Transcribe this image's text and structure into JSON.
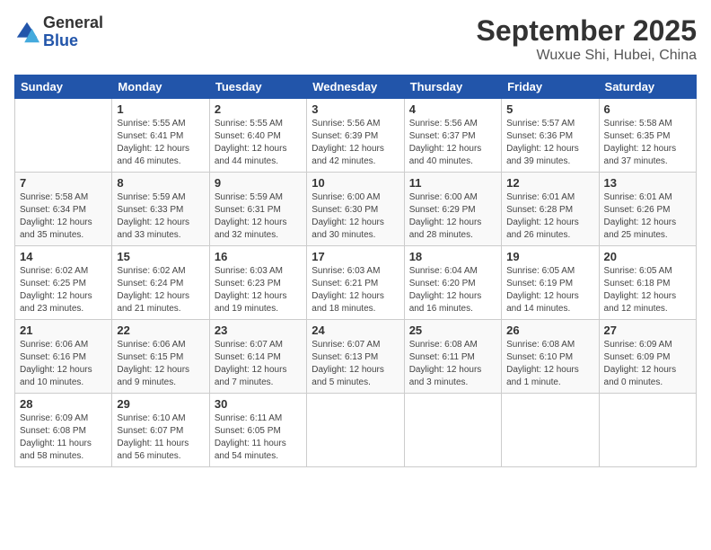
{
  "header": {
    "logo_line1": "General",
    "logo_line2": "Blue",
    "month": "September 2025",
    "location": "Wuxue Shi, Hubei, China"
  },
  "weekdays": [
    "Sunday",
    "Monday",
    "Tuesday",
    "Wednesday",
    "Thursday",
    "Friday",
    "Saturday"
  ],
  "weeks": [
    [
      {
        "day": "",
        "info": ""
      },
      {
        "day": "1",
        "info": "Sunrise: 5:55 AM\nSunset: 6:41 PM\nDaylight: 12 hours\nand 46 minutes."
      },
      {
        "day": "2",
        "info": "Sunrise: 5:55 AM\nSunset: 6:40 PM\nDaylight: 12 hours\nand 44 minutes."
      },
      {
        "day": "3",
        "info": "Sunrise: 5:56 AM\nSunset: 6:39 PM\nDaylight: 12 hours\nand 42 minutes."
      },
      {
        "day": "4",
        "info": "Sunrise: 5:56 AM\nSunset: 6:37 PM\nDaylight: 12 hours\nand 40 minutes."
      },
      {
        "day": "5",
        "info": "Sunrise: 5:57 AM\nSunset: 6:36 PM\nDaylight: 12 hours\nand 39 minutes."
      },
      {
        "day": "6",
        "info": "Sunrise: 5:58 AM\nSunset: 6:35 PM\nDaylight: 12 hours\nand 37 minutes."
      }
    ],
    [
      {
        "day": "7",
        "info": "Sunrise: 5:58 AM\nSunset: 6:34 PM\nDaylight: 12 hours\nand 35 minutes."
      },
      {
        "day": "8",
        "info": "Sunrise: 5:59 AM\nSunset: 6:33 PM\nDaylight: 12 hours\nand 33 minutes."
      },
      {
        "day": "9",
        "info": "Sunrise: 5:59 AM\nSunset: 6:31 PM\nDaylight: 12 hours\nand 32 minutes."
      },
      {
        "day": "10",
        "info": "Sunrise: 6:00 AM\nSunset: 6:30 PM\nDaylight: 12 hours\nand 30 minutes."
      },
      {
        "day": "11",
        "info": "Sunrise: 6:00 AM\nSunset: 6:29 PM\nDaylight: 12 hours\nand 28 minutes."
      },
      {
        "day": "12",
        "info": "Sunrise: 6:01 AM\nSunset: 6:28 PM\nDaylight: 12 hours\nand 26 minutes."
      },
      {
        "day": "13",
        "info": "Sunrise: 6:01 AM\nSunset: 6:26 PM\nDaylight: 12 hours\nand 25 minutes."
      }
    ],
    [
      {
        "day": "14",
        "info": "Sunrise: 6:02 AM\nSunset: 6:25 PM\nDaylight: 12 hours\nand 23 minutes."
      },
      {
        "day": "15",
        "info": "Sunrise: 6:02 AM\nSunset: 6:24 PM\nDaylight: 12 hours\nand 21 minutes."
      },
      {
        "day": "16",
        "info": "Sunrise: 6:03 AM\nSunset: 6:23 PM\nDaylight: 12 hours\nand 19 minutes."
      },
      {
        "day": "17",
        "info": "Sunrise: 6:03 AM\nSunset: 6:21 PM\nDaylight: 12 hours\nand 18 minutes."
      },
      {
        "day": "18",
        "info": "Sunrise: 6:04 AM\nSunset: 6:20 PM\nDaylight: 12 hours\nand 16 minutes."
      },
      {
        "day": "19",
        "info": "Sunrise: 6:05 AM\nSunset: 6:19 PM\nDaylight: 12 hours\nand 14 minutes."
      },
      {
        "day": "20",
        "info": "Sunrise: 6:05 AM\nSunset: 6:18 PM\nDaylight: 12 hours\nand 12 minutes."
      }
    ],
    [
      {
        "day": "21",
        "info": "Sunrise: 6:06 AM\nSunset: 6:16 PM\nDaylight: 12 hours\nand 10 minutes."
      },
      {
        "day": "22",
        "info": "Sunrise: 6:06 AM\nSunset: 6:15 PM\nDaylight: 12 hours\nand 9 minutes."
      },
      {
        "day": "23",
        "info": "Sunrise: 6:07 AM\nSunset: 6:14 PM\nDaylight: 12 hours\nand 7 minutes."
      },
      {
        "day": "24",
        "info": "Sunrise: 6:07 AM\nSunset: 6:13 PM\nDaylight: 12 hours\nand 5 minutes."
      },
      {
        "day": "25",
        "info": "Sunrise: 6:08 AM\nSunset: 6:11 PM\nDaylight: 12 hours\nand 3 minutes."
      },
      {
        "day": "26",
        "info": "Sunrise: 6:08 AM\nSunset: 6:10 PM\nDaylight: 12 hours\nand 1 minute."
      },
      {
        "day": "27",
        "info": "Sunrise: 6:09 AM\nSunset: 6:09 PM\nDaylight: 12 hours\nand 0 minutes."
      }
    ],
    [
      {
        "day": "28",
        "info": "Sunrise: 6:09 AM\nSunset: 6:08 PM\nDaylight: 11 hours\nand 58 minutes."
      },
      {
        "day": "29",
        "info": "Sunrise: 6:10 AM\nSunset: 6:07 PM\nDaylight: 11 hours\nand 56 minutes."
      },
      {
        "day": "30",
        "info": "Sunrise: 6:11 AM\nSunset: 6:05 PM\nDaylight: 11 hours\nand 54 minutes."
      },
      {
        "day": "",
        "info": ""
      },
      {
        "day": "",
        "info": ""
      },
      {
        "day": "",
        "info": ""
      },
      {
        "day": "",
        "info": ""
      }
    ]
  ]
}
